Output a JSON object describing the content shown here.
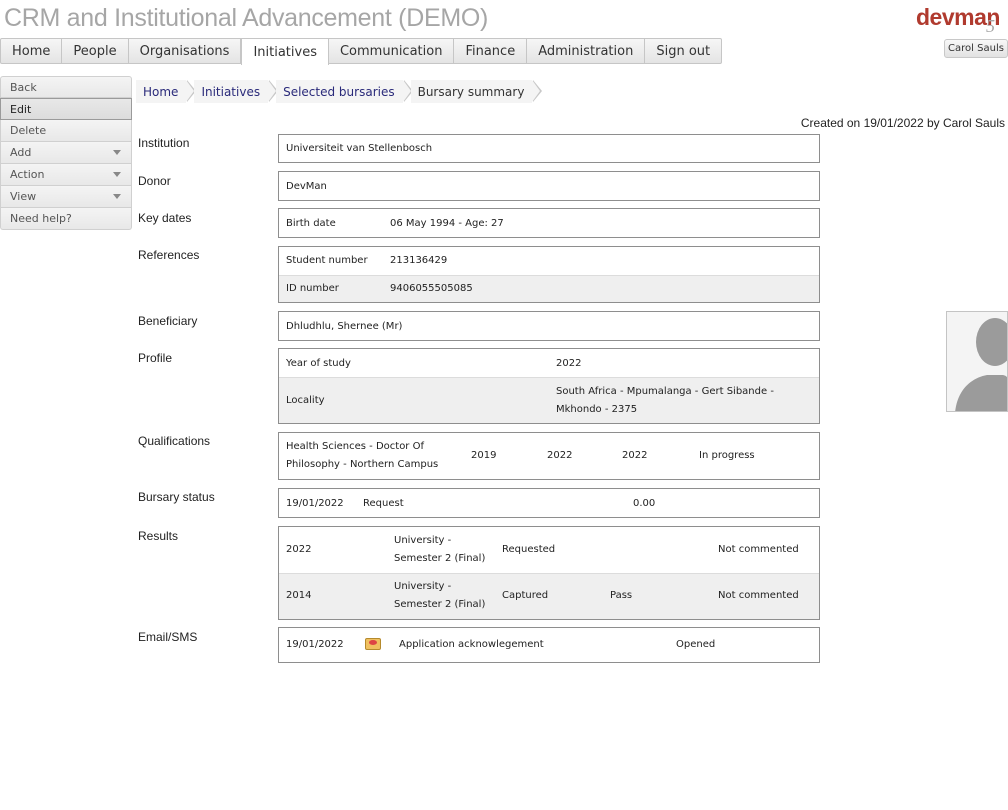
{
  "app": {
    "title": "CRM and Institutional Advancement (DEMO)",
    "logo_text": "devman",
    "logo_version": "5",
    "user_name": "Carol Sauls"
  },
  "menu": [
    {
      "label": "Home"
    },
    {
      "label": "People"
    },
    {
      "label": "Organisations"
    },
    {
      "label": "Initiatives",
      "active": true
    },
    {
      "label": "Communication"
    },
    {
      "label": "Finance"
    },
    {
      "label": "Administration"
    },
    {
      "label": "Sign out"
    }
  ],
  "sidebar": [
    {
      "label": "Back"
    },
    {
      "label": "Edit",
      "active": true
    },
    {
      "label": "Delete"
    },
    {
      "label": "Add",
      "dropdown": true
    },
    {
      "label": "Action",
      "dropdown": true
    },
    {
      "label": "View",
      "dropdown": true
    },
    {
      "label": "Need help?"
    }
  ],
  "breadcrumb": [
    "Home",
    "Initiatives",
    "Selected bursaries",
    "Bursary summary"
  ],
  "created": "Created on 19/01/2022 by Carol Sauls",
  "labels": {
    "institution": "Institution",
    "donor": "Donor",
    "key_dates": "Key dates",
    "references": "References",
    "beneficiary": "Beneficiary",
    "profile": "Profile",
    "qualifications": "Qualifications",
    "bursary_status": "Bursary status",
    "results": "Results",
    "email_sms": "Email/SMS"
  },
  "institution": "Universiteit van Stellenbosch",
  "donor": "DevMan",
  "key_dates": {
    "label": "Birth date",
    "value": "06 May 1994 - Age: 27"
  },
  "references": [
    {
      "label": "Student number",
      "value": "213136429"
    },
    {
      "label": "ID number",
      "value": "9406055505085"
    }
  ],
  "beneficiary": "Dhludhlu, Shernee (Mr)",
  "profile": [
    {
      "label": "Year of study",
      "value": "2022"
    },
    {
      "label": "Locality",
      "value": "South Africa - Mpumalanga - Gert Sibande - Mkhondo - 2375"
    }
  ],
  "qualification": {
    "name": "Health Sciences - Doctor Of Philosophy - Northern Campus",
    "start": "2019",
    "end": "2022",
    "year": "2022",
    "status": "In progress"
  },
  "bursary_status": {
    "date": "19/01/2022",
    "status": "Request",
    "amount": "0.00"
  },
  "results": [
    {
      "year": "2022",
      "period": "University - Semester 2 (Final)",
      "state": "Requested",
      "outcome": "",
      "comment": "Not commented"
    },
    {
      "year": "2014",
      "period": "University - Semester 2 (Final)",
      "state": "Captured",
      "outcome": "Pass",
      "comment": "Not commented"
    }
  ],
  "email_sms": {
    "date": "19/01/2022",
    "icon": "envelope-icon",
    "subject": "Application acknowlegement",
    "status": "Opened"
  },
  "colors": {
    "logo": "#b03a2e",
    "title": "#a6a6a6",
    "link": "#2a2a7a"
  }
}
